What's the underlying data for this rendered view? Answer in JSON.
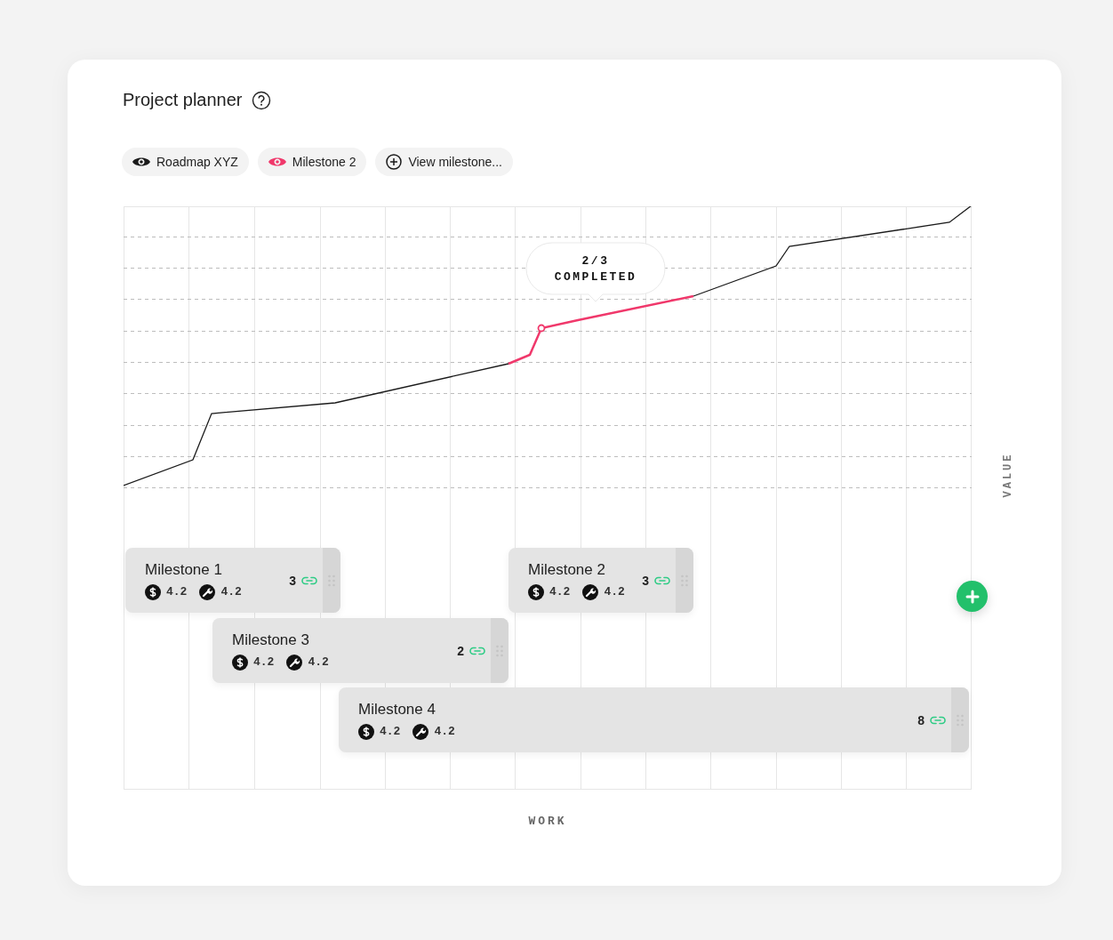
{
  "header": {
    "title": "Project planner"
  },
  "filters": [
    {
      "kind": "eye",
      "label": "Roadmap XYZ",
      "color": "#1a1a1a"
    },
    {
      "kind": "eye",
      "label": "Milestone 2",
      "color": "#f0386b"
    },
    {
      "kind": "add",
      "label": "View milestone..."
    }
  ],
  "chart": {
    "tooltip": {
      "count": "2/3",
      "label": "COMPLETED"
    },
    "y_axis_label": "VALUE",
    "x_axis_label": "WORK"
  },
  "milestones": [
    {
      "name": "Milestone 1",
      "cost": "4.2",
      "effort": "4.2",
      "links": "3"
    },
    {
      "name": "Milestone 2",
      "cost": "4.2",
      "effort": "4.2",
      "links": "3"
    },
    {
      "name": "Milestone 3",
      "cost": "4.2",
      "effort": "4.2",
      "links": "2"
    },
    {
      "name": "Milestone 4",
      "cost": "4.2",
      "effort": "4.2",
      "links": "8"
    }
  ]
}
